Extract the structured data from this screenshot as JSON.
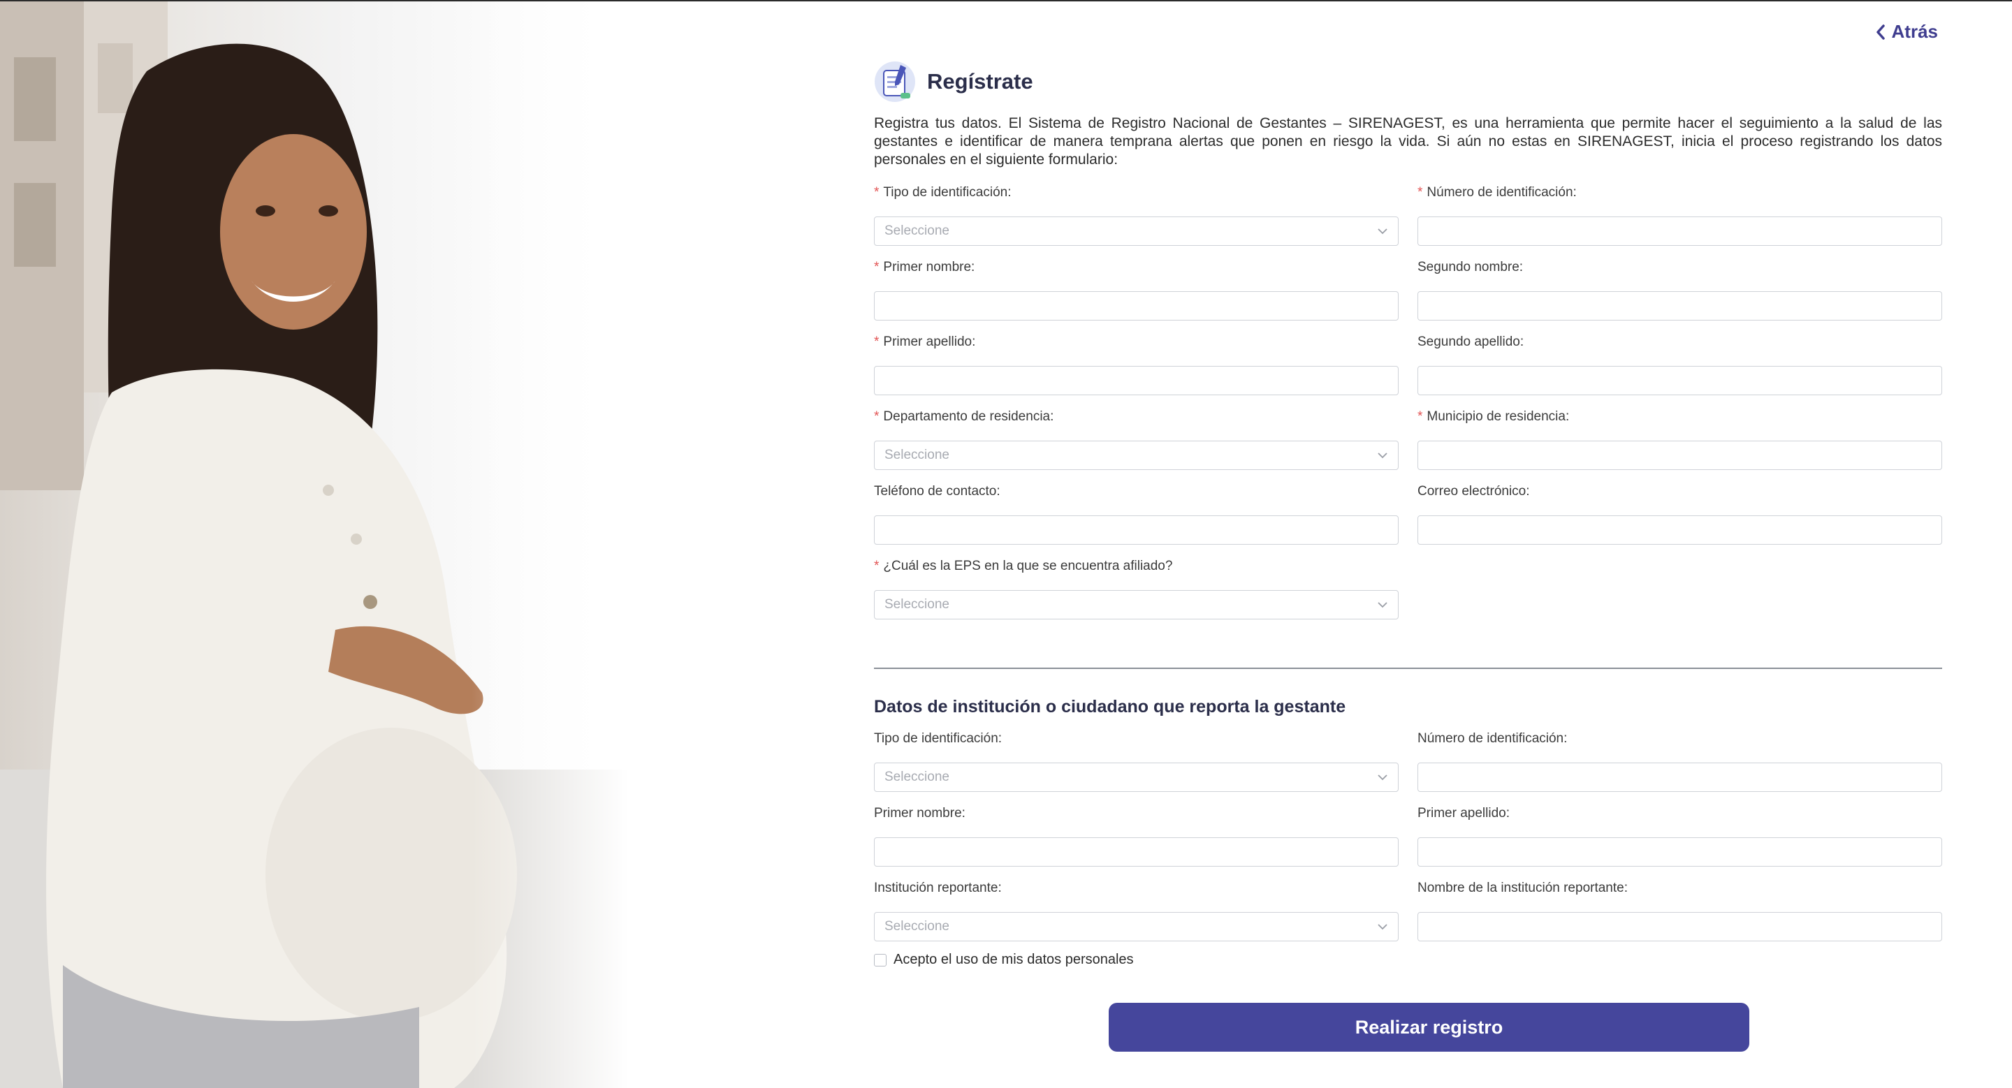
{
  "nav": {
    "back_label": "Atrás"
  },
  "header": {
    "title": "Regístrate"
  },
  "intro": "Registra tus datos. El Sistema de Registro Nacional de Gestantes – SIRENAGEST, es una herramienta que permite hacer el seguimiento a la salud de las gestantes e identificar de manera temprana alertas que ponen en riesgo la vida. Si aún no estas en SIRENAGEST, inicia el proceso registrando los datos personales en el siguiente formulario:",
  "form": {
    "tipo_id": {
      "label": "Tipo de identificación:",
      "required": "*",
      "placeholder": "Seleccione"
    },
    "numero_id": {
      "label": "Número de identificación:",
      "required": "*"
    },
    "primer_nombre": {
      "label": "Primer nombre:",
      "required": "*"
    },
    "segundo_nombre": {
      "label": "Segundo nombre:"
    },
    "primer_apellido": {
      "label": "Primer apellido:",
      "required": "*"
    },
    "segundo_apellido": {
      "label": "Segundo apellido:"
    },
    "departamento": {
      "label": "Departamento de residencia:",
      "required": "*",
      "placeholder": "Seleccione"
    },
    "municipio": {
      "label": "Municipio de residencia:",
      "required": "*"
    },
    "telefono": {
      "label": "Teléfono de contacto:"
    },
    "correo": {
      "label": "Correo electrónico:"
    },
    "eps": {
      "label": "¿Cuál es la EPS en la que se encuentra afiliado?",
      "required": "*",
      "placeholder": "Seleccione"
    }
  },
  "reporter": {
    "title": "Datos de institución o ciudadano que reporta la gestante",
    "tipo_id": {
      "label": "Tipo de identificación:",
      "placeholder": "Seleccione"
    },
    "numero_id": {
      "label": "Número de identificación:"
    },
    "primer_nombre": {
      "label": "Primer nombre:"
    },
    "primer_apellido": {
      "label": "Primer apellido:"
    },
    "institucion": {
      "label": "Institución reportante:",
      "placeholder": "Seleccione"
    },
    "nombre_institucion": {
      "label": "Nombre de la institución reportante:"
    }
  },
  "consent": {
    "label": "Acepto el uso de mis datos personales",
    "checked": false
  },
  "submit": {
    "label": "Realizar registro"
  },
  "colors": {
    "accent": "#45469c",
    "required": "#e25353",
    "title": "#2b2e4a"
  }
}
